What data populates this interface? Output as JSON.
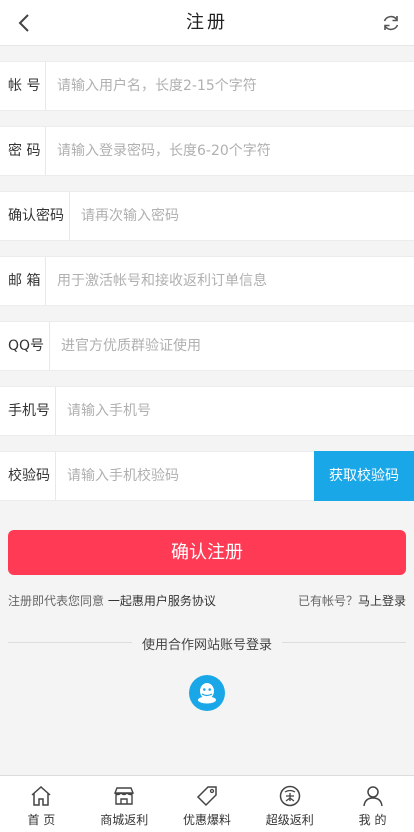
{
  "header": {
    "title": "注册"
  },
  "form": {
    "account": {
      "label": "帐 号",
      "placeholder": "请输入用户名，长度2-15个字符"
    },
    "password": {
      "label": "密 码",
      "placeholder": "请输入登录密码，长度6-20个字符"
    },
    "confirm_password": {
      "label": "确认密码",
      "placeholder": "请再次输入密码"
    },
    "email": {
      "label": "邮 箱",
      "placeholder": "用于激活帐号和接收返利订单信息"
    },
    "qq": {
      "label": "QQ号",
      "placeholder": "进官方优质群验证使用"
    },
    "phone": {
      "label": "手机号",
      "placeholder": "请输入手机号"
    },
    "verify_code": {
      "label": "校验码",
      "placeholder": "请输入手机校验码",
      "button": "获取校验码"
    }
  },
  "submit_label": "确认注册",
  "agreement": {
    "prefix": "注册即代表您同意 ",
    "link": "一起惠用户服务协议"
  },
  "login": {
    "prefix": "已有帐号？",
    "link": "马上登录"
  },
  "third_party": {
    "text": "使用合作网站账号登录",
    "provider_icon": "qq-icon"
  },
  "tabbar": [
    {
      "label": "首 页",
      "icon": "home-icon"
    },
    {
      "label": "商城返利",
      "icon": "store-icon"
    },
    {
      "label": "优惠爆料",
      "icon": "tag-icon"
    },
    {
      "label": "超级返利",
      "icon": "rebate-icon"
    },
    {
      "label": "我 的",
      "icon": "user-icon"
    }
  ],
  "colors": {
    "primary": "#fe3a55",
    "accent": "#1aa7e8",
    "background": "#f4f4f4"
  }
}
